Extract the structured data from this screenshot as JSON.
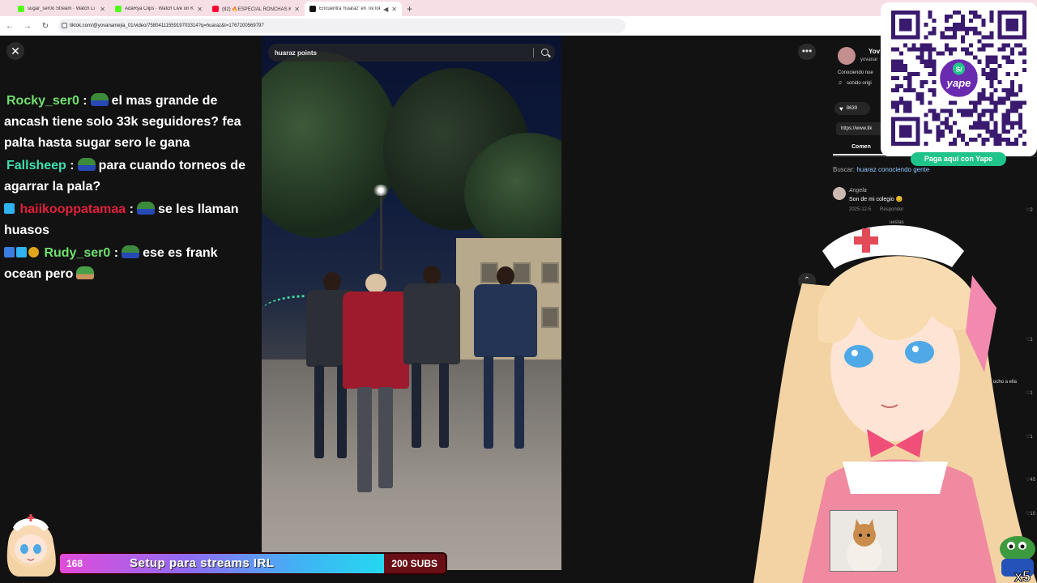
{
  "browser": {
    "tabs": [
      {
        "title": "sugar_ser0o Stream · Watch Li",
        "color": "#53fc18"
      },
      {
        "title": "AdaRya Clips · Watch Live on K",
        "color": "#53fc18"
      },
      {
        "title": "(82) 🔥ESPECIAL RONCHAS K",
        "color": "#ff0033"
      },
      {
        "title": "Encuentra 'huaraz' en TikTok",
        "color": "#111111"
      }
    ],
    "url": "tiktok.com/@yovanamejia_01/video/7580411155919703314?q=huaraz&t=1767200569797"
  },
  "video": {
    "search_value": "huaraz points"
  },
  "chat": {
    "messages": [
      {
        "user": "Rocky_ser0",
        "user_color": "#6fe06f",
        "sep": ":",
        "text": "el mas grande de ancash tiene solo 33k seguidores? fea palta hasta sugar sero le gana"
      },
      {
        "user": "Fallsheep",
        "user_color": "#3de0b0",
        "sep": ":",
        "text": "para cuando torneos de agarrar la pala?"
      },
      {
        "user": "haiikooppatamaa",
        "user_color": "#e0203a",
        "sep": ":",
        "text": "se les llaman huasos"
      },
      {
        "user": "Rudy_ser0",
        "user_color": "#6fe06f",
        "sep": ":",
        "text": "ese es frank ocean pero"
      }
    ]
  },
  "side": {
    "creator_name": "Yov",
    "creator_handle": "yovanar",
    "caption": "Conociendo nue",
    "sound": "sonido origi",
    "likes": "8639",
    "link": "https://www.tik",
    "comments_tab": "Comen",
    "search_label": "Buscar:",
    "search_query": "huaraz conociendo gente",
    "comment_author": "Angela",
    "comment_text": "Son de mi colegio 😊",
    "comment_date": "2025-12-5",
    "reply_label": "Responder",
    "view_replies": "uestas",
    "side_snippet": "ucho a ella",
    "heart_counts": [
      "2",
      "1",
      "1",
      "1",
      "45",
      "10"
    ]
  },
  "qr": {
    "caption": "Paga aquí con Yape",
    "brand": "yape",
    "currency": "S/"
  },
  "goal": {
    "current": "168",
    "title": "Setup para streams IRL",
    "target": "200 SUBS",
    "progress": 0.84
  },
  "corner_badge": "x5"
}
